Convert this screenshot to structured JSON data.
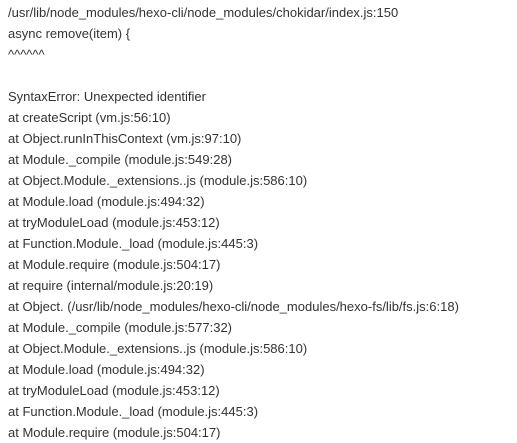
{
  "console": {
    "lines": [
      "/usr/lib/node_modules/hexo-cli/node_modules/chokidar/index.js:150",
      "async remove(item) {",
      "^^^^^^",
      "",
      "SyntaxError: Unexpected identifier",
      "at createScript (vm.js:56:10)",
      "at Object.runInThisContext (vm.js:97:10)",
      "at Module._compile (module.js:549:28)",
      "at Object.Module._extensions..js (module.js:586:10)",
      "at Module.load (module.js:494:32)",
      "at tryModuleLoad (module.js:453:12)",
      "at Function.Module._load (module.js:445:3)",
      "at Module.require (module.js:504:17)",
      "at require (internal/module.js:20:19)",
      "at Object. (/usr/lib/node_modules/hexo-cli/node_modules/hexo-fs/lib/fs.js:6:18)",
      "at Module._compile (module.js:577:32)",
      "at Object.Module._extensions..js (module.js:586:10)",
      "at Module.load (module.js:494:32)",
      "at tryModuleLoad (module.js:453:12)",
      "at Function.Module._load (module.js:445:3)",
      "at Module.require (module.js:504:17)"
    ]
  }
}
